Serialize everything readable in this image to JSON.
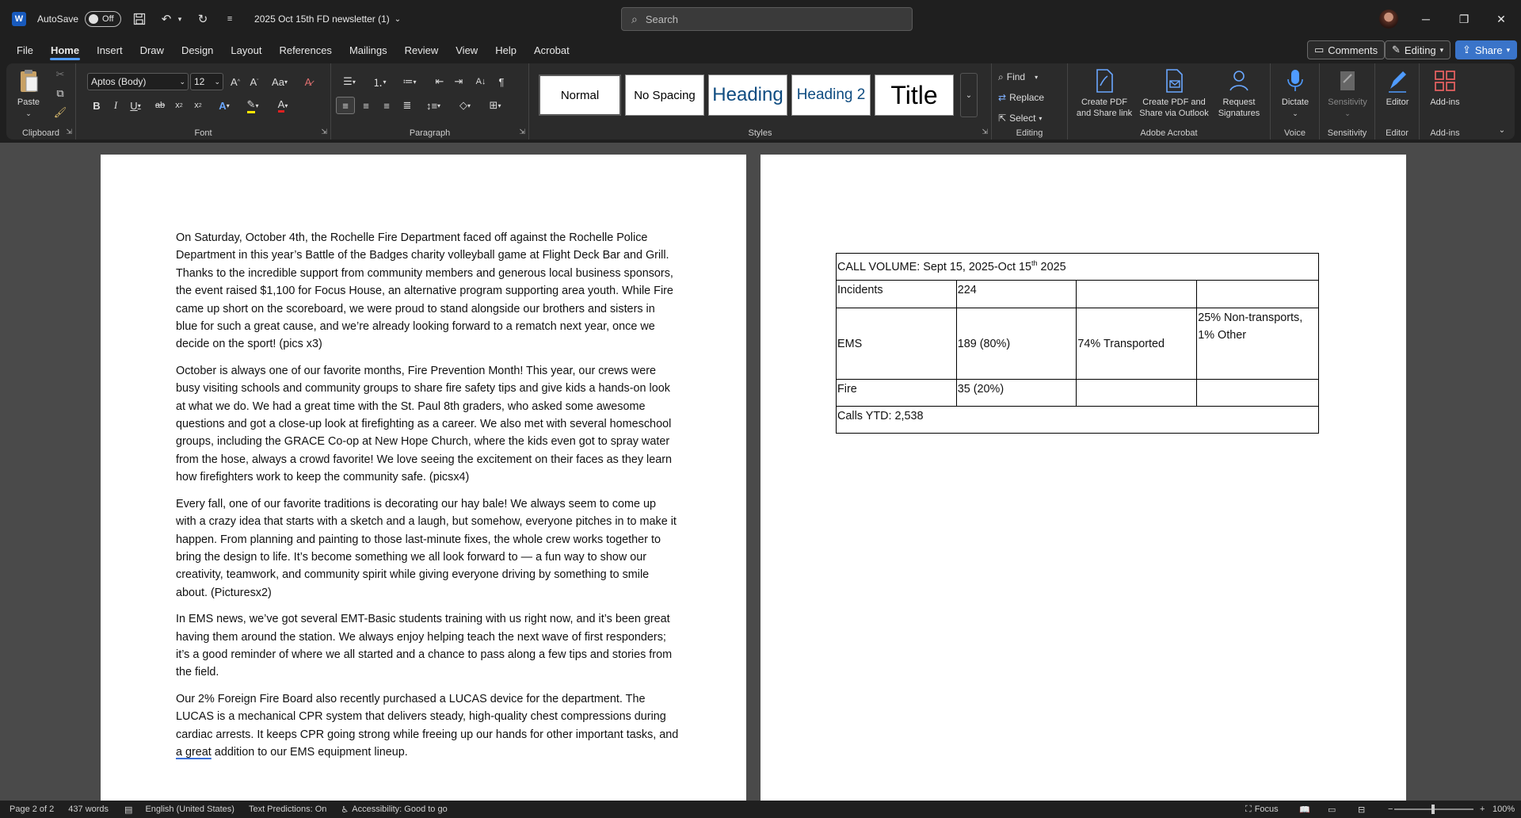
{
  "titlebar": {
    "app_letter": "W",
    "autosave_label": "AutoSave",
    "autosave_state": "Off",
    "doc_title": "2025 Oct 15th FD newsletter (1)",
    "search_placeholder": "Search"
  },
  "menu": {
    "items": [
      "File",
      "Home",
      "Insert",
      "Draw",
      "Design",
      "Layout",
      "References",
      "Mailings",
      "Review",
      "View",
      "Help",
      "Acrobat"
    ],
    "active": "Home",
    "comments_label": "Comments",
    "editing_label": "Editing",
    "share_label": "Share"
  },
  "ribbon": {
    "clipboard": {
      "label": "Clipboard",
      "paste": "Paste"
    },
    "font": {
      "label": "Font",
      "name": "Aptos (Body)",
      "size": "12"
    },
    "paragraph": {
      "label": "Paragraph"
    },
    "styles": {
      "label": "Styles",
      "items": [
        "Normal",
        "No Spacing",
        "Heading",
        "Heading 2",
        "Title"
      ]
    },
    "editing": {
      "label": "Editing",
      "find": "Find",
      "replace": "Replace",
      "select": "Select"
    },
    "acrobat": {
      "label": "Adobe Acrobat",
      "b1": "Create PDF and Share link",
      "b2": "Create PDF and Share via Outlook",
      "b3": "Request Signatures"
    },
    "voice": {
      "label": "Voice",
      "dictate": "Dictate"
    },
    "sensitivity": {
      "label": "Sensitivity",
      "btn": "Sensitivity"
    },
    "editor": {
      "label": "Editor",
      "btn": "Editor"
    },
    "addins": {
      "label": "Add-ins",
      "btn": "Add-ins"
    }
  },
  "page1": {
    "paragraphs": [
      "On Saturday, October 4th, the Rochelle Fire Department faced off against the Rochelle Police Department in this year’s Battle of the Badges charity volleyball game at Flight Deck Bar and Grill. Thanks to the incredible support from community members and generous local business sponsors, the event raised $1,100 for Focus House, an alternative program supporting area youth. While Fire came up short on the scoreboard, we were proud to stand alongside our brothers and sisters in blue for such a great cause, and we’re already looking forward to a rematch next year, once we decide on the sport! (pics x3)",
      "October is always one of our favorite months, Fire Prevention Month! This year, our crews were busy visiting schools and community groups to share fire safety tips and give kids a hands-on look at what we do. We had a great time with the St. Paul 8th graders, who asked some awesome questions and got a close-up look at firefighting as a career. We also met with several homeschool groups, including the GRACE Co-op at New Hope Church, where the kids even got to spray water from the hose, always a crowd favorite! We love seeing the excitement on their faces as they learn how firefighters work to keep the community safe. (picsx4)",
      "Every fall, one of our favorite traditions is decorating our hay bale! We always seem to come up with a crazy idea that starts with a sketch and a laugh, but somehow, everyone pitches in to make it happen. From planning and painting to those last-minute fixes, the whole crew works together to bring the design to life. It’s become something we all look forward to — a fun way to show our creativity, teamwork, and community spirit while giving everyone driving by something to smile about. (Picturesx2)",
      "In EMS news, we’ve got several EMT-Basic students training with us right now, and it’s been great having them around the station. We always enjoy helping teach the next wave of first responders; it’s a good reminder of where we all started and a chance to pass along a few tips and stories from the field."
    ],
    "last_paragraph_before": "Our 2% Foreign Fire Board also recently purchased a LUCAS device for the department. The LUCAS is a mechanical CPR system that delivers steady, high-quality chest compressions during cardiac arrests. It keeps CPR going strong while freeing up our hands for other important tasks, and ",
    "last_paragraph_underlined": "a great",
    "last_paragraph_after": " addition to our EMS equipment lineup."
  },
  "page2": {
    "table_title_before": "CALL VOLUME: Sept 15, 2025-Oct 15",
    "table_title_sup": "th",
    "table_title_after": " 2025",
    "rows": [
      [
        "Incidents",
        "224",
        "",
        ""
      ],
      [
        "EMS",
        "189 (80%)",
        "74% Transported",
        "25% Non-transports, 1% Other"
      ],
      [
        "Fire",
        "35 (20%)",
        "",
        ""
      ]
    ],
    "footer": "Calls YTD: 2,538"
  },
  "status": {
    "page": "Page 2 of 2",
    "words": "437 words",
    "language": "English (United States)",
    "predictions": "Text Predictions: On",
    "accessibility": "Accessibility: Good to go",
    "focus": "Focus",
    "zoom": "100%"
  },
  "colors": {
    "accent": "#4f9bff",
    "share": "#3a74c9",
    "word_blue": "#185abd"
  }
}
